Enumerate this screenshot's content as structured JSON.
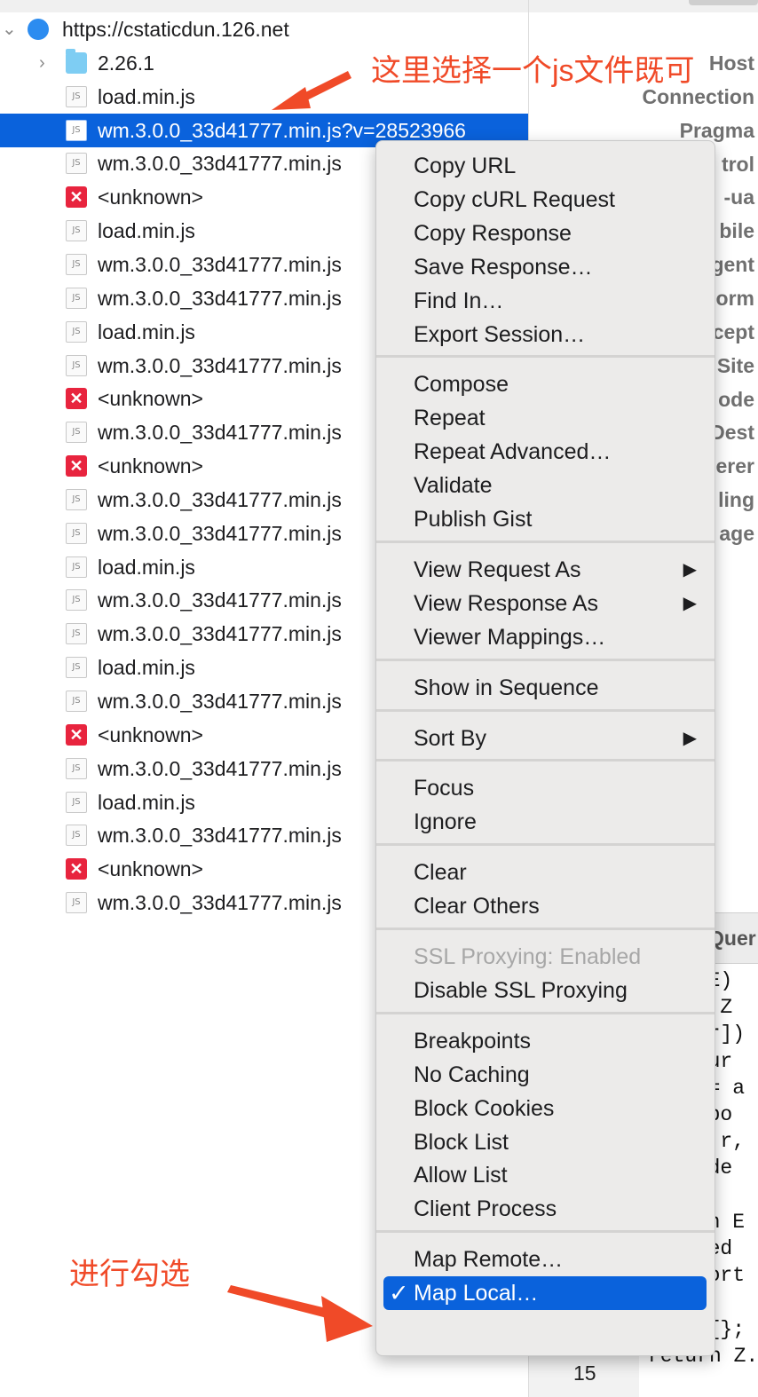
{
  "tree": {
    "host": "https://cstaticdun.126.net",
    "folder": "2.26.1",
    "files": [
      {
        "label": "load.min.js",
        "type": "js"
      },
      {
        "label": "wm.3.0.0_33d41777.min.js?v=28523966",
        "type": "js",
        "selected": true
      },
      {
        "label": "wm.3.0.0_33d41777.min.js",
        "type": "js"
      },
      {
        "label": "<unknown>",
        "type": "error"
      },
      {
        "label": "load.min.js",
        "type": "js"
      },
      {
        "label": "wm.3.0.0_33d41777.min.js",
        "type": "js"
      },
      {
        "label": "wm.3.0.0_33d41777.min.js",
        "type": "js"
      },
      {
        "label": "load.min.js",
        "type": "js"
      },
      {
        "label": "wm.3.0.0_33d41777.min.js",
        "type": "js"
      },
      {
        "label": "<unknown>",
        "type": "error"
      },
      {
        "label": "wm.3.0.0_33d41777.min.js",
        "type": "js"
      },
      {
        "label": "<unknown>",
        "type": "error"
      },
      {
        "label": "wm.3.0.0_33d41777.min.js",
        "type": "js"
      },
      {
        "label": "wm.3.0.0_33d41777.min.js",
        "type": "js"
      },
      {
        "label": "load.min.js",
        "type": "js"
      },
      {
        "label": "wm.3.0.0_33d41777.min.js",
        "type": "js"
      },
      {
        "label": "wm.3.0.0_33d41777.min.js",
        "type": "js"
      },
      {
        "label": "load.min.js",
        "type": "js"
      },
      {
        "label": "wm.3.0.0_33d41777.min.js",
        "type": "js"
      },
      {
        "label": "<unknown>",
        "type": "error"
      },
      {
        "label": "wm.3.0.0_33d41777.min.js",
        "type": "js"
      },
      {
        "label": "load.min.js",
        "type": "js"
      },
      {
        "label": "wm.3.0.0_33d41777.min.js",
        "type": "js"
      },
      {
        "label": "<unknown>",
        "type": "error"
      },
      {
        "label": "wm.3.0.0_33d41777.min.js",
        "type": "js"
      }
    ],
    "js_badge": "JS",
    "error_badge": "✕"
  },
  "headers": [
    "Host",
    "Connection",
    "Pragma",
    "trol",
    "-ua",
    "bile",
    "gent",
    "orm",
    "cept",
    "Site",
    "ode",
    "Dest",
    "erer",
    "ling",
    "age"
  ],
  "lower_pane": {
    "tab": "Quer",
    "code_lines": [
      "n(E)",
      "on Z",
      "a[r])",
      "etur",
      "t = a",
      "expo",
      "d: r,",
      "oade",
      "",
      "urn E",
      "aded",
      "xport",
      "",
      "= {};",
      "return Z.n"
    ],
    "line_number": "15"
  },
  "menu": {
    "groups": [
      [
        "Copy URL",
        "Copy cURL Request",
        "Copy Response",
        "Save Response…",
        "Find In…",
        "Export Session…"
      ],
      [
        "Compose",
        "Repeat",
        "Repeat Advanced…",
        "Validate",
        "Publish Gist"
      ],
      [
        "View Request As",
        "View Response As",
        "Viewer Mappings…"
      ],
      [
        "Show in Sequence"
      ],
      [
        "Sort By"
      ],
      [
        "Focus",
        "Ignore"
      ],
      [
        "Clear",
        "Clear Others"
      ],
      [
        "SSL Proxying: Enabled",
        "Disable SSL Proxying"
      ],
      [
        "Breakpoints",
        "No Caching",
        "Block Cookies",
        "Block List",
        "Allow List",
        "Client Process"
      ],
      [
        "Map Remote…",
        "Map Local…"
      ]
    ],
    "submenu_items": [
      "View Request As",
      "View Response As",
      "Sort By"
    ],
    "disabled_items": [
      "SSL Proxying: Enabled"
    ],
    "checked_item": "Map Local…",
    "check_mark": "✓",
    "submenu_arrow": "▶"
  },
  "annotations": {
    "top_note": "这里选择一个js文件既可",
    "bottom_note": "进行勾选"
  },
  "colors": {
    "selection": "#0a62dc",
    "annotation": "#f04a28",
    "error_badge": "#e8243e",
    "folder": "#7ecdf3",
    "menu_bg": "#ecebea"
  }
}
